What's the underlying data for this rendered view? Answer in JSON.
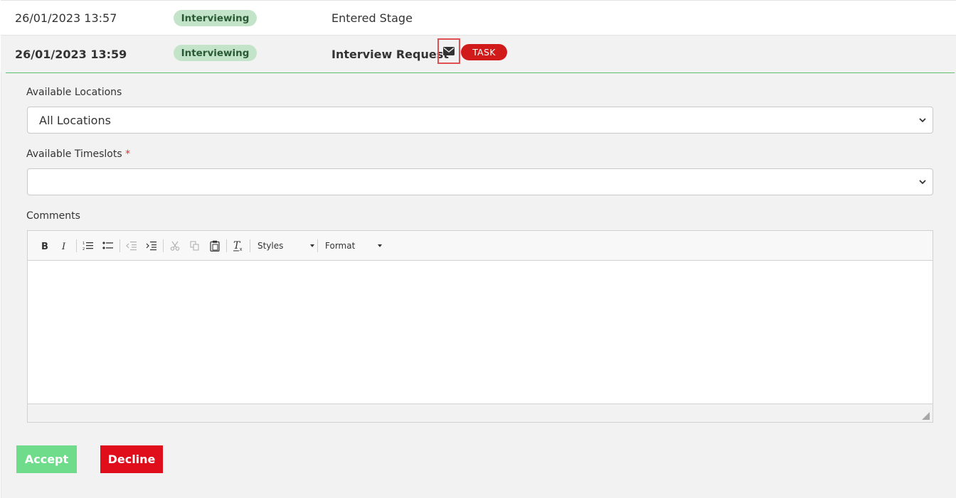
{
  "history": [
    {
      "date": "26/01/2023 13:57",
      "stage": "Interviewing",
      "event": "Entered Stage"
    },
    {
      "date": "26/01/2023 13:59",
      "stage": "Interviewing",
      "event": "Interview Request",
      "badge": "TASK"
    }
  ],
  "form": {
    "locations_label": "Available Locations",
    "locations_value": "All Locations",
    "timeslots_label": "Available Timeslots",
    "timeslots_required": "*",
    "timeslots_value": "",
    "comments_label": "Comments"
  },
  "editor": {
    "styles_label": "Styles",
    "format_label": "Format",
    "content": ""
  },
  "actions": {
    "accept_label": "Accept",
    "decline_label": "Decline"
  },
  "colors": {
    "stage_pill_bg": "#c3e4c8",
    "task_badge": "#d11a1a",
    "accept": "#6fdc8c",
    "decline": "#e00d1b",
    "divider_green": "#5cbf6c"
  },
  "icons": [
    "mail-icon",
    "bold-icon",
    "italic-icon",
    "numbered-list-icon",
    "bulleted-list-icon",
    "outdent-icon",
    "indent-icon",
    "cut-icon",
    "copy-icon",
    "paste-icon",
    "clear-format-icon",
    "chevron-down-icon",
    "resize-grip-icon"
  ]
}
